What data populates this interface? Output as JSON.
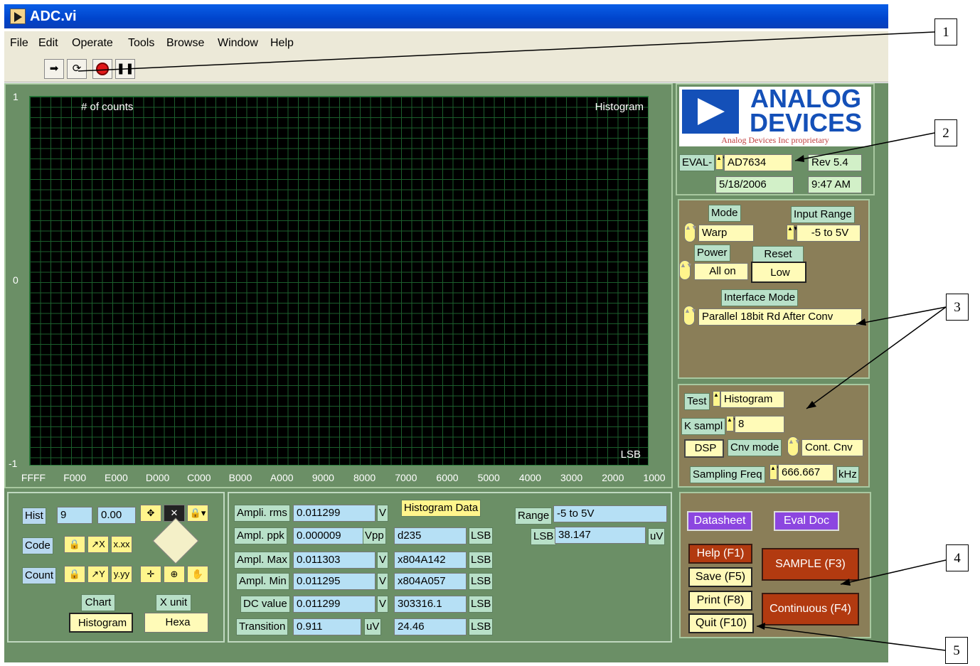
{
  "window": {
    "title": "ADC.vi"
  },
  "menu": [
    "File",
    "Edit",
    "Operate",
    "Tools",
    "Browse",
    "Window",
    "Help"
  ],
  "toolbar": {
    "run_icon": "run-arrow-icon",
    "run_continuous_icon": "run-continuous-icon",
    "abort_icon": "abort-stop-icon",
    "pause_icon": "pause-icon"
  },
  "graph": {
    "ylabel": "# of counts",
    "title": "Histogram",
    "xunit": "LSB",
    "yticks": [
      "1",
      "0",
      "-1"
    ],
    "xticks": [
      "FFFF",
      "F000",
      "E000",
      "D000",
      "C000",
      "B000",
      "A000",
      "9000",
      "8000",
      "7000",
      "6000",
      "5000",
      "4000",
      "3000",
      "2000",
      "1000"
    ]
  },
  "brand": {
    "logo_line1": "ANALOG",
    "logo_line2": "DEVICES",
    "proprietary": "Analog Devices Inc proprietary"
  },
  "eval": {
    "prefix": "EVAL-",
    "part": "AD7634",
    "rev": "Rev 5.4",
    "date": "5/18/2006",
    "time": "9:47 AM"
  },
  "settings": {
    "mode_label": "Mode",
    "mode_value": "Warp",
    "input_range_label": "Input Range",
    "input_range_value": "-5 to 5V",
    "power_label": "Power",
    "power_value": "All on",
    "reset_label": "Reset",
    "reset_value": "Low",
    "interface_label": "Interface Mode",
    "interface_value": "Parallel 18bit Rd After Conv"
  },
  "test": {
    "test_label": "Test",
    "test_value": "Histogram",
    "ksampl_label": "K sampl",
    "ksampl_value": "8",
    "dsp_label": "DSP",
    "cnv_label": "Cnv mode",
    "cnv_value": "Cont. Cnv",
    "freq_label": "Sampling Freq",
    "freq_value": "666.667",
    "freq_unit": "kHz"
  },
  "graph_controls": {
    "hist_label": "Hist",
    "hist_value": "9",
    "hist_value2": "0.00",
    "code_label": "Code",
    "count_label": "Count",
    "chart_label": "Chart",
    "chart_value": "Histogram",
    "xunit_label": "X unit",
    "xunit_value": "Hexa"
  },
  "measurements": {
    "rows": [
      {
        "label": "Ampli. rms",
        "value": "0.011299",
        "unit": "V"
      },
      {
        "label": "Ampl. ppk",
        "value": "0.000009",
        "unit": "Vpp"
      },
      {
        "label": "Ampl. Max",
        "value": "0.011303",
        "unit": "V"
      },
      {
        "label": "Ampl. Min",
        "value": "0.011295",
        "unit": "V"
      },
      {
        "label": "DC value",
        "value": "0.011299",
        "unit": "V"
      },
      {
        "label": "Transition",
        "value": "0.911",
        "unit": "uV"
      }
    ],
    "hist_data_label": "Histogram Data",
    "hist_rows": [
      {
        "value": "d235",
        "unit": "LSB"
      },
      {
        "value": "x804A142",
        "unit": "LSB"
      },
      {
        "value": "x804A057",
        "unit": "LSB"
      },
      {
        "value": "303316.1",
        "unit": "LSB"
      },
      {
        "value": "24.46",
        "unit": "LSB"
      }
    ],
    "range_label": "Range",
    "range_value": "-5 to 5V",
    "lsb_label": "LSB",
    "lsb_value": "38.147",
    "lsb_unit": "uV"
  },
  "buttons": {
    "datasheet": "Datasheet",
    "evaldoc": "Eval Doc",
    "help": "Help (F1)",
    "save": "Save (F5)",
    "print": "Print (F8)",
    "quit": "Quit (F10)",
    "sample": "SAMPLE (F3)",
    "continuous": "Continuous (F4)"
  },
  "callouts": [
    "1",
    "2",
    "3",
    "4",
    "5"
  ]
}
